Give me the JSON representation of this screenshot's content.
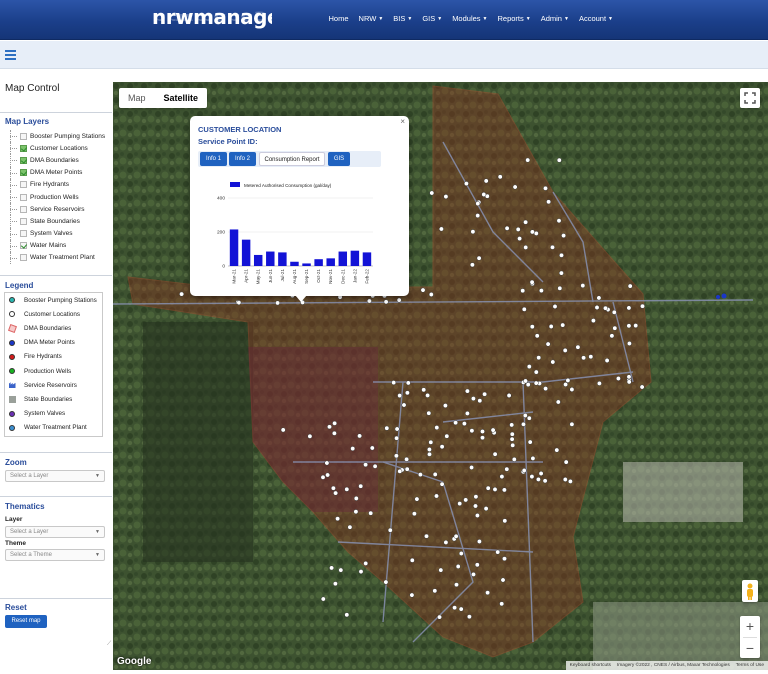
{
  "header": {
    "logo": "nrwmanager",
    "nav": [
      {
        "label": "Home",
        "caret": false
      },
      {
        "label": "NRW",
        "caret": true
      },
      {
        "label": "BIS",
        "caret": true
      },
      {
        "label": "GIS",
        "caret": true
      },
      {
        "label": "Modules",
        "caret": true
      },
      {
        "label": "Reports",
        "caret": true
      },
      {
        "label": "Admin",
        "caret": true
      },
      {
        "label": "Account",
        "caret": true
      }
    ]
  },
  "sidebar": {
    "title": "Map Control",
    "layers_title": "Map Layers",
    "layers": [
      {
        "label": "Booster Pumping Stations",
        "checked": false
      },
      {
        "label": "Customer Locations",
        "checked": true
      },
      {
        "label": "DMA Boundaries",
        "checked": true
      },
      {
        "label": "DMA Meter Points",
        "checked": true
      },
      {
        "label": "Fire Hydrants",
        "checked": false
      },
      {
        "label": "Production Wells",
        "checked": false
      },
      {
        "label": "Service Reservoirs",
        "checked": false
      },
      {
        "label": "State Boundaries",
        "checked": false
      },
      {
        "label": "System Valves",
        "checked": false
      },
      {
        "label": "Water Mains",
        "checked": true
      },
      {
        "label": "Water Treatment Plant",
        "checked": false
      }
    ],
    "legend_title": "Legend",
    "legend": [
      {
        "label": "Booster Pumping Stations",
        "icon": "teal-dot-icon",
        "color": "#2bb6b0"
      },
      {
        "label": "Customer Locations",
        "icon": "white-dot-icon",
        "color": "#ffffff"
      },
      {
        "label": "DMA Boundaries",
        "icon": "boundary-icon",
        "color": "#e8a0a0"
      },
      {
        "label": "DMA Meter Points",
        "icon": "blue-dot-icon",
        "color": "#1a36c8"
      },
      {
        "label": "Fire Hydrants",
        "icon": "red-dot-icon",
        "color": "#d21b1b"
      },
      {
        "label": "Production Wells",
        "icon": "green-dot-icon",
        "color": "#18b321"
      },
      {
        "label": "Service Reservoirs",
        "icon": "reservoir-icon",
        "color": "#3a63c9"
      },
      {
        "label": "State Boundaries",
        "icon": "state-boundary-icon",
        "color": "#9aa09a"
      },
      {
        "label": "System Valves",
        "icon": "purple-dot-icon",
        "color": "#6a2fb3"
      },
      {
        "label": "Water Treatment Plant",
        "icon": "globe-icon",
        "color": "#3c8fd0"
      }
    ],
    "zoom_title": "Zoom",
    "zoom_placeholder": "Select a Layer",
    "thematics_title": "Thematics",
    "layer_label": "Layer",
    "layer_placeholder": "Select a Layer",
    "theme_label": "Theme",
    "theme_placeholder": "Select a Theme",
    "reset_title": "Reset",
    "reset_button": "Reset map"
  },
  "map": {
    "type_map": "Map",
    "type_satellite": "Satellite",
    "google": "Google",
    "attrib": [
      "Keyboard shortcuts",
      "Imagery ©2022 , CNES / Airbus, Maxar Technologies",
      "Terms of Use"
    ],
    "zoom_in": "+",
    "zoom_out": "−"
  },
  "popup": {
    "title": "CUSTOMER LOCATION",
    "subtitle": "Service Point ID:",
    "close": "×",
    "tabs": [
      "Info 1",
      "Info 2",
      "Consumption Report",
      "GIS"
    ]
  },
  "chart_data": {
    "type": "bar",
    "legend": "Metered Authorised Consumption (gal/day)",
    "series_color": "#1313d6",
    "categories": [
      "Mar-21",
      "Apr-21",
      "May-21",
      "Jun-21",
      "Jul-21",
      "Aug-21",
      "Sep-21",
      "Oct-21",
      "Nov-21",
      "Dec-21",
      "Jan-22",
      "Feb-22"
    ],
    "values": [
      215,
      155,
      65,
      85,
      80,
      25,
      15,
      40,
      45,
      85,
      90,
      80
    ],
    "ylim": [
      0,
      400
    ],
    "yticks": [
      0,
      200,
      400
    ]
  }
}
